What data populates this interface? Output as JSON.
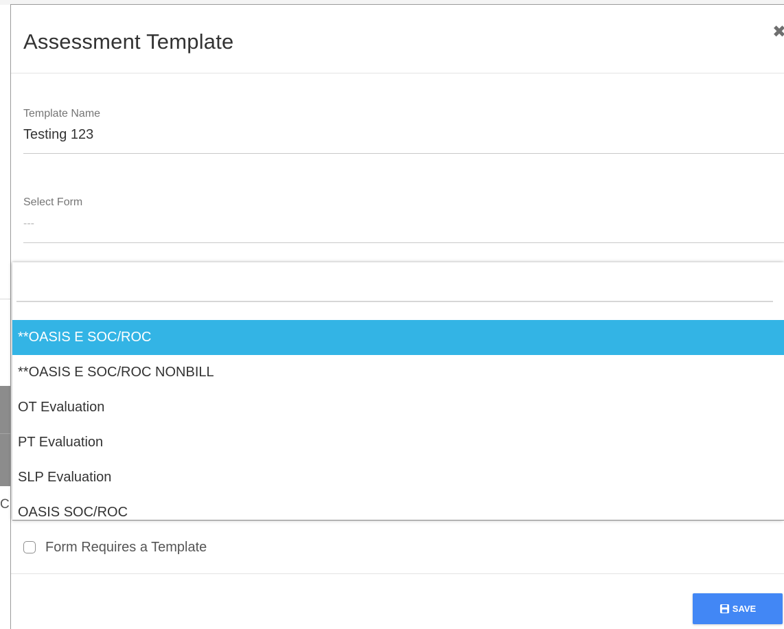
{
  "modal": {
    "title": "Assessment Template",
    "close_icon": "close-icon",
    "close_glyph": "✖"
  },
  "template_name": {
    "label": "Template Name",
    "value": "Testing 123"
  },
  "select_form": {
    "label": "Select Form",
    "selected_value": "---",
    "search_value": "",
    "options": [
      {
        "label": "**OASIS E SOC/ROC",
        "highlighted": true
      },
      {
        "label": "**OASIS E SOC/ROC NONBILL",
        "highlighted": false
      },
      {
        "label": "OT Evaluation",
        "highlighted": false
      },
      {
        "label": "PT Evaluation",
        "highlighted": false
      },
      {
        "label": "SLP Evaluation",
        "highlighted": false
      },
      {
        "label": "OASIS SOC/ROC",
        "highlighted": false
      }
    ]
  },
  "background": {
    "partial_text": "Cr"
  },
  "checkbox": {
    "label": "Form Requires a Template",
    "checked": false
  },
  "save_button": {
    "label": "SAVE",
    "icon": "save-icon"
  },
  "colors": {
    "highlight": "#33b4e5",
    "primary_button": "#4287f5"
  }
}
